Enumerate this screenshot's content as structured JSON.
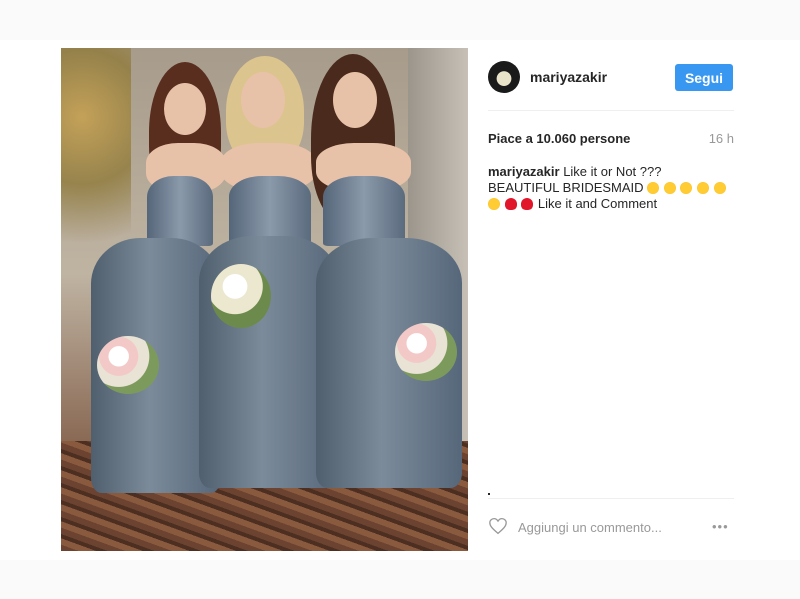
{
  "post": {
    "username": "mariyazakir",
    "follow_label": "Segui",
    "likes_text": "Piace a 10.060 persone",
    "time_ago": "16 h",
    "caption_author": "mariyazakir",
    "caption_part1": "Like it or Not ???BEAUTIFUL BRIDESMAID",
    "caption_part2": "Like it and Comment",
    "comment_placeholder": "Aggiungi un commento...",
    "more_label": "•••"
  },
  "colors": {
    "follow_button": "#3897f0",
    "text_primary": "#262626",
    "text_muted": "#999999",
    "divider": "#efefef"
  },
  "icons": {
    "like": "heart-outline-icon",
    "more": "ellipsis-icon"
  }
}
